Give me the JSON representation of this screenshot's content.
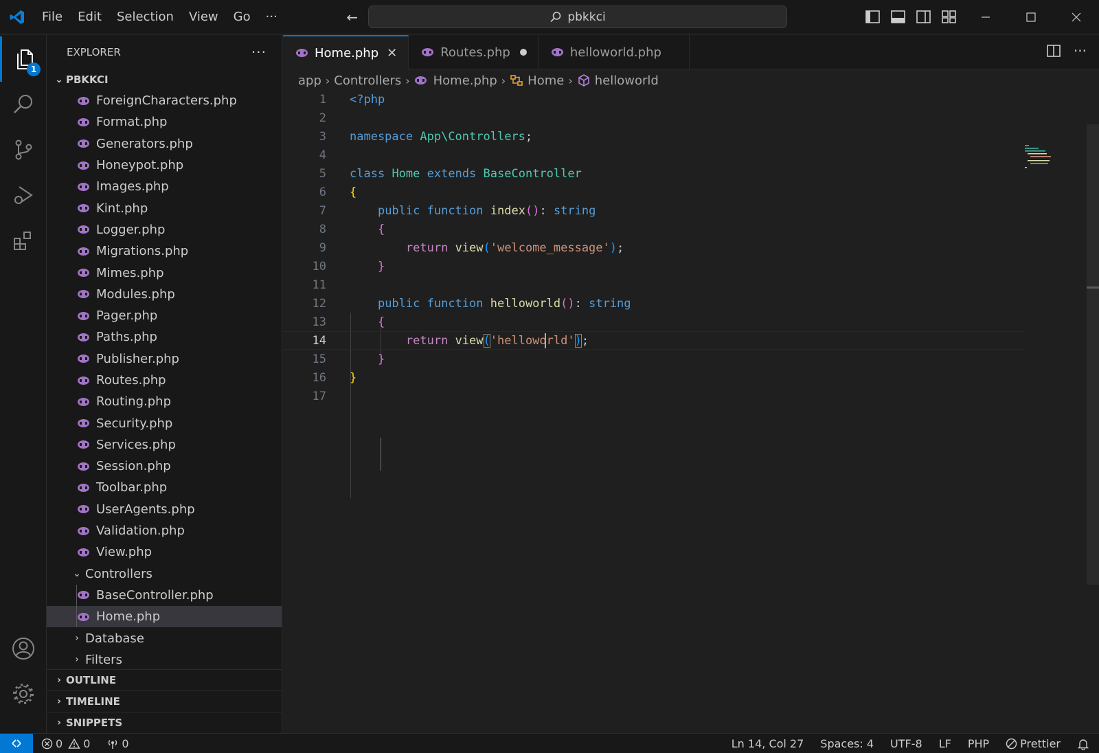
{
  "menu": [
    "File",
    "Edit",
    "Selection",
    "View",
    "Go",
    "···"
  ],
  "search": {
    "text": "pbkkci"
  },
  "activity": {
    "explorer_badge": "1"
  },
  "sidebar": {
    "title": "EXPLORER",
    "root": "PBKKCI",
    "files": [
      "ForeignCharacters.php",
      "Format.php",
      "Generators.php",
      "Honeypot.php",
      "Images.php",
      "Kint.php",
      "Logger.php",
      "Migrations.php",
      "Mimes.php",
      "Modules.php",
      "Pager.php",
      "Paths.php",
      "Publisher.php",
      "Routes.php",
      "Routing.php",
      "Security.php",
      "Services.php",
      "Session.php",
      "Toolbar.php",
      "UserAgents.php",
      "Validation.php",
      "View.php"
    ],
    "controllers_folder": "Controllers",
    "controller_files": [
      "BaseController.php",
      "Home.php"
    ],
    "folders_after": [
      "Database",
      "Filters"
    ],
    "sections": [
      "OUTLINE",
      "TIMELINE",
      "SNIPPETS"
    ]
  },
  "tabs": [
    {
      "label": "Home.php",
      "state": "active"
    },
    {
      "label": "Routes.php",
      "state": "dirty"
    },
    {
      "label": "helloworld.php",
      "state": "normal"
    }
  ],
  "breadcrumbs": [
    "app",
    "Controllers",
    "Home.php",
    "Home",
    "helloworld"
  ],
  "code": {
    "line_numbers": [
      "1",
      "2",
      "3",
      "4",
      "5",
      "6",
      "7",
      "8",
      "9",
      "10",
      "11",
      "12",
      "13",
      "14",
      "15",
      "16",
      "17"
    ],
    "current_line": "14"
  },
  "status": {
    "errors": "0",
    "warnings": "0",
    "ports": "0",
    "position": "Ln 14, Col 27",
    "spaces": "Spaces: 4",
    "encoding": "UTF-8",
    "eol": "LF",
    "language": "PHP",
    "formatter": "Prettier"
  },
  "colors": {
    "accent": "#0078d4",
    "php_icon": "#a074c4",
    "keyword": "#569cd6",
    "class": "#4ec9b0",
    "function": "#dcdcaa",
    "string": "#ce9178"
  }
}
